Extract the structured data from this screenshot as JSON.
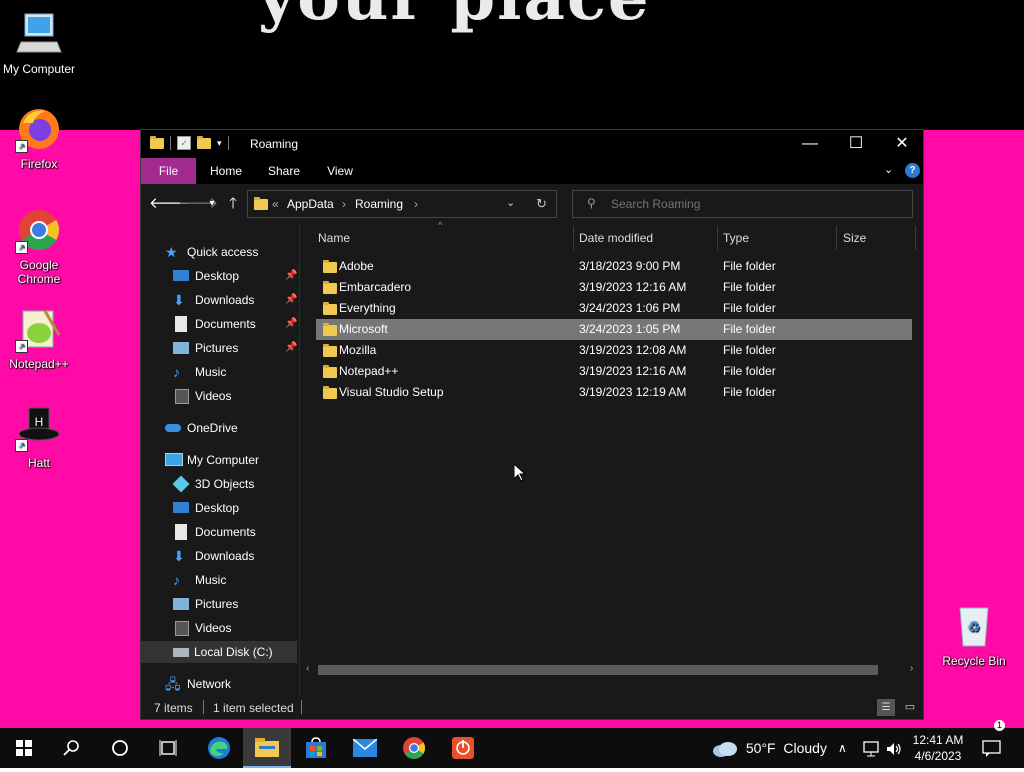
{
  "wallpaper": {
    "text": "your place"
  },
  "desktop_icons": [
    {
      "label": "My Computer"
    },
    {
      "label": "Firefox"
    },
    {
      "label": "Google Chrome"
    },
    {
      "label": "Notepad++"
    },
    {
      "label": "Hatt"
    },
    {
      "label": "Recycle Bin"
    }
  ],
  "window": {
    "title": "Roaming",
    "controls": {
      "minimize": "—",
      "maximize": "☐",
      "close": "✕"
    }
  },
  "ribbon": {
    "tabs": [
      "File",
      "Home",
      "Share",
      "View"
    ],
    "file_color": "#a32b8f"
  },
  "address": {
    "overflow": "«",
    "crumbs": [
      "AppData",
      "Roaming"
    ],
    "separator": "›"
  },
  "search": {
    "placeholder": "Search Roaming"
  },
  "nav": {
    "quick_access": "Quick access",
    "quick_items": [
      "Desktop",
      "Downloads",
      "Documents",
      "Pictures",
      "Music",
      "Videos"
    ],
    "onedrive": "OneDrive",
    "this_pc": "My Computer",
    "pc_items": [
      "3D Objects",
      "Desktop",
      "Documents",
      "Downloads",
      "Music",
      "Pictures",
      "Videos",
      "Local Disk (C:)"
    ],
    "network": "Network"
  },
  "columns": [
    "Name",
    "Date modified",
    "Type",
    "Size"
  ],
  "files": [
    {
      "name": "Adobe",
      "date": "3/18/2023 9:00 PM",
      "type": "File folder",
      "selected": false
    },
    {
      "name": "Embarcadero",
      "date": "3/19/2023 12:16 AM",
      "type": "File folder",
      "selected": false
    },
    {
      "name": "Everything",
      "date": "3/24/2023 1:06 PM",
      "type": "File folder",
      "selected": false
    },
    {
      "name": "Microsoft",
      "date": "3/24/2023 1:05 PM",
      "type": "File folder",
      "selected": true
    },
    {
      "name": "Mozilla",
      "date": "3/19/2023 12:08 AM",
      "type": "File folder",
      "selected": false
    },
    {
      "name": "Notepad++",
      "date": "3/19/2023 12:16 AM",
      "type": "File folder",
      "selected": false
    },
    {
      "name": "Visual Studio Setup",
      "date": "3/19/2023 12:19 AM",
      "type": "File folder",
      "selected": false
    }
  ],
  "status": {
    "count": "7 items",
    "selection": "1 item selected"
  },
  "taskbar": {
    "apps": [
      "start-icon",
      "search-icon",
      "cortana-icon",
      "task-view-icon",
      "edge-icon",
      "file-explorer-icon",
      "store-icon",
      "mail-icon",
      "chrome-icon",
      "app-icon"
    ],
    "weather": "50°F  Cloudy",
    "time": "12:41 AM",
    "date": "4/6/2023",
    "notifications": "1"
  },
  "colors": {
    "wallpaper": "#ff0aa6",
    "window_bg": "#191919",
    "selection": "#777777",
    "folder": "#f1c950"
  }
}
